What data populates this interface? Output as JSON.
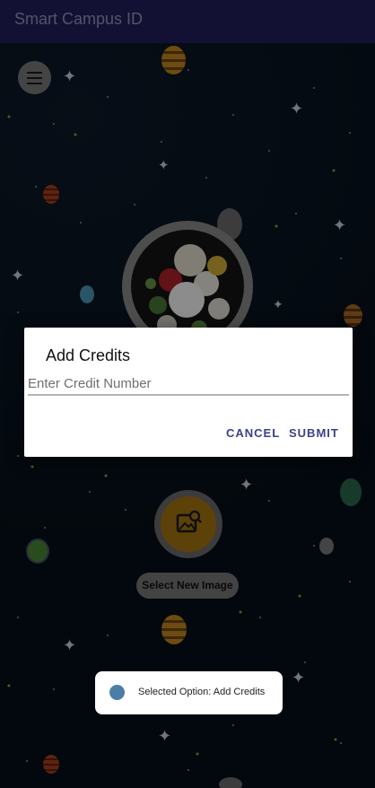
{
  "app_bar": {
    "title": "Smart Campus ID"
  },
  "dialog": {
    "title": "Add Credits",
    "input_placeholder": "Enter Credit Number",
    "cancel_label": "CANCEL",
    "submit_label": "SUBMIT"
  },
  "main": {
    "select_image_label": "Select New Image"
  },
  "toast": {
    "text": "Selected Option: Add Credits"
  },
  "icons": {
    "menu": "menu-icon",
    "avatar": "flower-bouquet-image",
    "fab": "image-search-icon",
    "toast": "app-icon"
  },
  "colors": {
    "app_bar": "#241f5e",
    "accent_button_text": "#3b3f8f",
    "fab_fill": "#a87812"
  }
}
